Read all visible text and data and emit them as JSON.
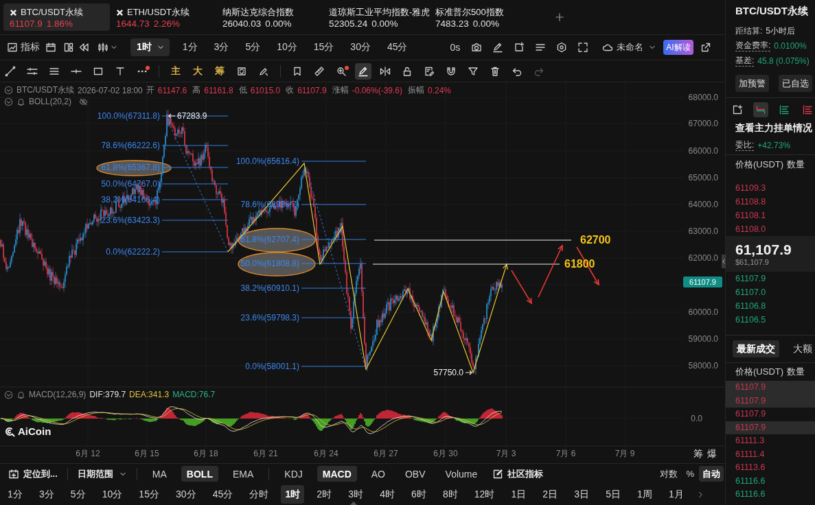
{
  "tickers": [
    {
      "kind": "crypto",
      "name": "BTC/USDT永续",
      "price": "61107.9",
      "change": "1.86%",
      "color": "#e5414f",
      "selected": true
    },
    {
      "kind": "crypto",
      "name": "ETH/USDT永续",
      "price": "1644.73",
      "change": "2.26%",
      "color": "#e5414f",
      "selected": false
    },
    {
      "kind": "index",
      "name": "纳斯达克综合指数",
      "price": "26040.03",
      "change": "0.00%",
      "color": "#e0e0e0",
      "selected": false
    },
    {
      "kind": "index",
      "name": "道琼斯工业平均指数-雅虎",
      "price": "52305.24",
      "change": "0.00%",
      "color": "#e0e0e0",
      "selected": false
    },
    {
      "kind": "index",
      "name": "标准普尔500指数",
      "price": "7483.23",
      "change": "0.00%",
      "color": "#e0e0e0",
      "selected": false
    }
  ],
  "toolbar": {
    "indicators": "指标",
    "interval": "1时",
    "intervals": [
      "1分",
      "3分",
      "5分",
      "10分",
      "15分",
      "30分",
      "45分"
    ],
    "countdown": "0s",
    "layout_name": "未命名",
    "ai_button": "AI解读"
  },
  "drawing_tools": [
    {
      "kind": "icon",
      "selected": false,
      "dot": false,
      "disabled": false
    },
    {
      "kind": "icon",
      "selected": false,
      "dot": false,
      "disabled": false
    },
    {
      "kind": "icon",
      "selected": false,
      "dot": false,
      "disabled": false
    },
    {
      "kind": "icon",
      "selected": false,
      "dot": false,
      "disabled": false
    },
    {
      "kind": "icon",
      "selected": false,
      "dot": false,
      "disabled": false
    },
    {
      "kind": "icon",
      "selected": false,
      "dot": false,
      "disabled": false
    },
    {
      "kind": "icon",
      "selected": false,
      "dot": true,
      "disabled": false
    },
    {
      "kind": "text",
      "label": "主",
      "selected": false,
      "dot": false,
      "disabled": false
    },
    {
      "kind": "text",
      "label": "大",
      "selected": false,
      "dot": false,
      "disabled": false
    },
    {
      "kind": "text",
      "label": "筹",
      "selected": false,
      "dot": false,
      "disabled": false
    },
    {
      "kind": "icon",
      "selected": false,
      "dot": false,
      "disabled": false
    },
    {
      "kind": "icon",
      "selected": false,
      "dot": false,
      "disabled": false
    },
    {
      "kind": "icon",
      "selected": false,
      "dot": false,
      "disabled": false
    },
    {
      "kind": "icon",
      "selected": false,
      "dot": false,
      "disabled": false
    },
    {
      "kind": "icon",
      "selected": false,
      "dot": true,
      "disabled": false
    },
    {
      "kind": "icon",
      "selected": true,
      "dot": false,
      "disabled": false
    },
    {
      "kind": "icon",
      "selected": false,
      "dot": false,
      "disabled": false
    },
    {
      "kind": "icon",
      "selected": false,
      "dot": false,
      "disabled": false
    },
    {
      "kind": "icon",
      "selected": false,
      "dot": false,
      "disabled": false
    },
    {
      "kind": "icon",
      "selected": false,
      "dot": false,
      "disabled": false
    },
    {
      "kind": "icon",
      "selected": false,
      "dot": false,
      "disabled": false
    },
    {
      "kind": "icon",
      "selected": false,
      "dot": false,
      "disabled": false
    },
    {
      "kind": "icon",
      "selected": false,
      "dot": false,
      "disabled": false
    },
    {
      "kind": "icon",
      "selected": false,
      "dot": false,
      "disabled": true
    }
  ],
  "chart": {
    "symbol": "BTC/USDT永续",
    "time": "2026-07-02 18:00",
    "quote": [
      {
        "label": "开",
        "value": "61147.6"
      },
      {
        "label": "高",
        "value": "61161.8"
      },
      {
        "label": "低",
        "value": "61015.0"
      },
      {
        "label": "收",
        "value": "61107.9"
      },
      {
        "label": "涨幅",
        "value": "-0.06%(-39.6)"
      },
      {
        "label": "振幅",
        "value": "0.24%"
      }
    ],
    "overlay": "BOLL(20,2)",
    "price_axis": [
      "68000.0",
      "67000.0",
      "66000.0",
      "65000.0",
      "64000.0",
      "63000.0",
      "62000.0",
      "60000.0",
      "59000.0",
      "58000.0"
    ],
    "last_price": "61107.9",
    "fib_sets": [
      {
        "levels": [
          {
            "label": "100.0%(67311.8)",
            "highlighted": false
          },
          {
            "label": "78.6%(66222.6)",
            "highlighted": false
          },
          {
            "label": "61.8%(65367.8)",
            "highlighted": true
          },
          {
            "label": "50.0%(64767.0)",
            "highlighted": false
          },
          {
            "label": "38.2%(64166.4)",
            "highlighted": false
          },
          {
            "label": "23.6%(63423.3)",
            "highlighted": false
          },
          {
            "label": "0.0%(62222.2)",
            "highlighted": false
          }
        ]
      },
      {
        "levels": [
          {
            "label": "100.0%(65616.4)",
            "highlighted": false
          },
          {
            "label": "78.6%(63986.7)",
            "highlighted": false
          },
          {
            "label": "61.8%(62707.4)",
            "highlighted": true
          },
          {
            "label": "50.0%(61808.8)",
            "highlighted": true
          },
          {
            "label": "38.2%(60910.1)",
            "highlighted": false
          },
          {
            "label": "23.6%(59798.3)",
            "highlighted": false
          },
          {
            "label": "0.0%(58001.1)",
            "highlighted": false
          }
        ]
      }
    ],
    "markers": [
      {
        "kind": "high",
        "label": "67283.9"
      },
      {
        "kind": "low",
        "label": "57750.0"
      }
    ],
    "targets": [
      "62700",
      "61800"
    ],
    "dates": [
      "6月 12",
      "6月 15",
      "6月 18",
      "6月 21",
      "6月 24",
      "6月 27",
      "6月 30",
      "7月 3",
      "7月 6",
      "7月 9"
    ],
    "side_buttons": [
      "筹",
      "爆"
    ]
  },
  "macd": {
    "title": "MACD(12,26,9)",
    "dif": "DIF:379.7",
    "dea": "DEA:341.3",
    "value": "MACD:76.7",
    "axis": "0.0"
  },
  "logo": "AiCoin",
  "indicator_bar": {
    "locate": "定位到...",
    "date_range": "日期范围",
    "main": [
      {
        "label": "MA",
        "selected": false
      },
      {
        "label": "BOLL",
        "selected": true
      },
      {
        "label": "EMA",
        "selected": false
      }
    ],
    "sub": [
      {
        "label": "KDJ",
        "selected": false
      },
      {
        "label": "MACD",
        "selected": true
      },
      {
        "label": "AO",
        "selected": false
      },
      {
        "label": "OBV",
        "selected": false
      },
      {
        "label": "Volume",
        "selected": false
      }
    ],
    "community": "社区指标",
    "scale": [
      {
        "label": "对数",
        "selected": false
      },
      {
        "label": "%",
        "selected": false
      },
      {
        "label": "自动",
        "selected": true
      }
    ]
  },
  "periods": [
    {
      "label": "1分",
      "selected": false
    },
    {
      "label": "3分",
      "selected": false
    },
    {
      "label": "5分",
      "selected": false
    },
    {
      "label": "10分",
      "selected": false
    },
    {
      "label": "15分",
      "selected": false
    },
    {
      "label": "30分",
      "selected": false
    },
    {
      "label": "45分",
      "selected": false
    },
    {
      "label": "分时",
      "selected": false
    },
    {
      "label": "1时",
      "selected": true
    },
    {
      "label": "2时",
      "selected": false
    },
    {
      "label": "3时",
      "selected": false
    },
    {
      "label": "4时",
      "selected": false
    },
    {
      "label": "6时",
      "selected": false
    },
    {
      "label": "8时",
      "selected": false
    },
    {
      "label": "12时",
      "selected": false
    },
    {
      "label": "1日",
      "selected": false
    },
    {
      "label": "2日",
      "selected": false
    },
    {
      "label": "3日",
      "selected": false
    },
    {
      "label": "5日",
      "selected": false
    },
    {
      "label": "1周",
      "selected": false
    },
    {
      "label": "1月",
      "selected": false
    }
  ],
  "side_panel": {
    "symbol": "BTC/USDT永续",
    "stats": [
      {
        "kind": "plain",
        "label": "距结算:",
        "value": "5小时后"
      },
      {
        "kind": "rate",
        "label": "资金费率:",
        "value": "0.0100%"
      },
      {
        "kind": "rate",
        "label": "基差:",
        "value": "45.8 (0.075%)"
      }
    ],
    "buttons": [
      "加预警",
      "已自选"
    ],
    "view_modes": [
      {
        "selected": false
      },
      {
        "selected": true
      },
      {
        "selected": false
      },
      {
        "selected": false
      }
    ],
    "title": "查看主力挂单情况",
    "ratio_label": "委比:",
    "ratio": "+42.73%",
    "columns": [
      "价格(USDT)",
      "数量"
    ],
    "asks": [
      "61109.3",
      "61108.8",
      "61108.1",
      "61108.0"
    ],
    "mid_price": "61,107.9",
    "mid_price_usd": "$61,107.9",
    "bids": [
      "61107.9",
      "61107.0",
      "61106.8",
      "61106.5"
    ],
    "trade_tabs": [
      {
        "label": "最新成交",
        "selected": true
      },
      {
        "label": "大额",
        "selected": false
      }
    ],
    "trade_columns": [
      "价格(USDT)",
      "数量"
    ],
    "trades": [
      {
        "price": "61107.9",
        "color": "#c8374f",
        "highlighted": true
      },
      {
        "price": "61107.9",
        "color": "#c8374f",
        "highlighted": true
      },
      {
        "price": "61107.9",
        "color": "#c8374f",
        "highlighted": false
      },
      {
        "price": "61107.9",
        "color": "#c8374f",
        "highlighted": true
      },
      {
        "price": "61111.3",
        "color": "#c8374f",
        "highlighted": false
      },
      {
        "price": "61111.4",
        "color": "#c8374f",
        "highlighted": false
      },
      {
        "price": "61113.6",
        "color": "#c8374f",
        "highlighted": false
      },
      {
        "price": "61116.6",
        "color": "#1fa57a",
        "highlighted": false
      },
      {
        "price": "61116.6",
        "color": "#1fa57a",
        "highlighted": false
      }
    ]
  }
}
